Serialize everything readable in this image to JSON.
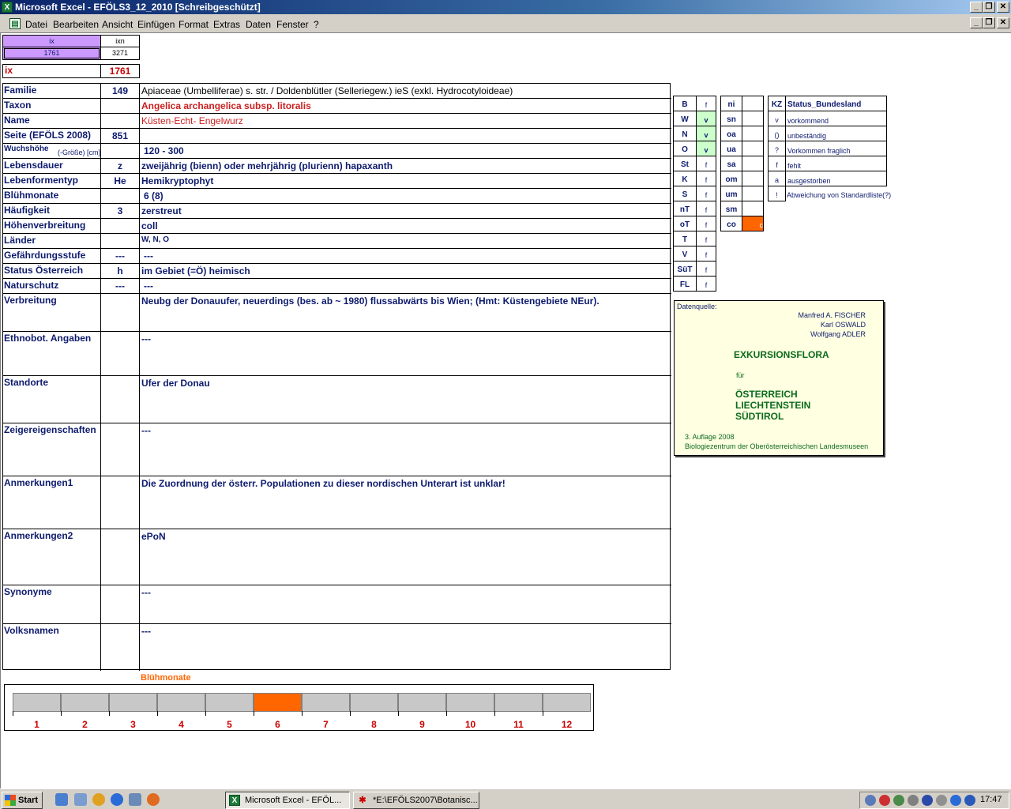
{
  "window": {
    "title": "Microsoft Excel - EFÖLS3_12_2010  [Schreibgeschützt]"
  },
  "menu": [
    "Datei",
    "Bearbeiten",
    "Ansicht",
    "Einfügen",
    "Format",
    "Extras",
    "Daten",
    "Fenster",
    "?"
  ],
  "index_box": {
    "ix_header": "ix",
    "ixn_header": "ixn",
    "ix_value": "1761",
    "ixn_value": "3271",
    "ix_label": "ix",
    "ix_big": "1761"
  },
  "rows": [
    {
      "label": "Familie",
      "code": "149",
      "value": "Apiaceae (Umbelliferae) s. str.  /  Doldenblütler (Selleriegew.) ieS (exkl. Hydrocotyloideae)"
    },
    {
      "label": "Taxon",
      "code": "",
      "value": "Angelica archangelica subsp. litoralis"
    },
    {
      "label": "Name",
      "code": "",
      "value": "Küsten-Echt- Engelwurz"
    },
    {
      "label": "Seite (EFÖLS 2008)",
      "code": "851",
      "value": ""
    },
    {
      "label": "Wuchshöhe",
      "label_suffix": "(-Größe) [cm]",
      "code": "",
      "value": "120 - 300"
    },
    {
      "label": "Lebensdauer",
      "code": "z",
      "value": "zweijährig (bienn) oder mehrjährig (plurienn) hapaxanth"
    },
    {
      "label": "Lebenformentyp",
      "code": "He",
      "value": "Hemikryptophyt"
    },
    {
      "label": "Blühmonate",
      "code": "",
      "value": "6 (8)"
    },
    {
      "label": "Häufigkeit",
      "code": "3",
      "value": "zerstreut"
    },
    {
      "label": "Höhenverbreitung",
      "code": "",
      "value": "coll"
    },
    {
      "label": "Länder",
      "code": "",
      "value": "W, N, O"
    },
    {
      "label": "Gefährdungsstufe",
      "code": "---",
      "value": "---"
    },
    {
      "label": "Status Österreich",
      "code": "h",
      "value": "im Gebiet (=Ö) heimisch"
    },
    {
      "label": "Naturschutz",
      "code": "---",
      "value": "---"
    },
    {
      "label": "Verbreitung",
      "code": "",
      "value": "Neubg der Donauufer, neuerdings (bes. ab ~ 1980) flussabwärts bis Wien; (Hmt: Küstengebiete NEur)."
    },
    {
      "label": "Ethnobot. Angaben",
      "code": "",
      "value": "---"
    },
    {
      "label": "Standorte",
      "code": "",
      "value": "Ufer der Donau"
    },
    {
      "label": "Zeigereigenschaften",
      "code": "",
      "value": "---"
    },
    {
      "label": "Anmerkungen1",
      "code": "",
      "value": "Die Zuordnung der österr. Populationen zu dieser nordischen Unterart ist unklar!"
    },
    {
      "label": "Anmerkungen2",
      "code": "",
      "value": "ePoN"
    },
    {
      "label": "Synonyme",
      "code": "",
      "value": "---"
    },
    {
      "label": "Volksnamen",
      "code": "",
      "value": "---"
    }
  ],
  "bundesland": [
    {
      "code": "B",
      "val": "f"
    },
    {
      "code": "W",
      "val": "v"
    },
    {
      "code": "N",
      "val": "v"
    },
    {
      "code": "O",
      "val": "v"
    },
    {
      "code": "St",
      "val": "f"
    },
    {
      "code": "K",
      "val": "f"
    },
    {
      "code": "S",
      "val": "f"
    },
    {
      "code": "nT",
      "val": "f"
    },
    {
      "code": "oT",
      "val": "f"
    },
    {
      "code": "T",
      "val": "f"
    },
    {
      "code": "V",
      "val": "f"
    },
    {
      "code": "SüT",
      "val": "f"
    },
    {
      "code": "FL",
      "val": "f"
    }
  ],
  "hoehe": [
    {
      "code": "ni",
      "val": ""
    },
    {
      "code": "sn",
      "val": ""
    },
    {
      "code": "oa",
      "val": ""
    },
    {
      "code": "ua",
      "val": ""
    },
    {
      "code": "sa",
      "val": ""
    },
    {
      "code": "om",
      "val": ""
    },
    {
      "code": "um",
      "val": ""
    },
    {
      "code": "sm",
      "val": ""
    },
    {
      "code": "co",
      "val": "c"
    }
  ],
  "legend": {
    "header_code": "KZ",
    "header_label": "Status_Bundesland",
    "items": [
      {
        "code": "v",
        "label": "vorkommend"
      },
      {
        "code": "()",
        "label": "unbeständig"
      },
      {
        "code": "?",
        "label": "Vorkommen fraglich"
      },
      {
        "code": "f",
        "label": "fehlt"
      },
      {
        "code": "a",
        "label": "ausgestorben"
      },
      {
        "code": "!",
        "label": "Abweichung von Standardliste(?)"
      }
    ]
  },
  "source": {
    "label": "Datenquelle:",
    "authors": [
      "Manfred A. FISCHER",
      "Karl OSWALD",
      "Wolfgang ADLER"
    ],
    "title": "EXKURSIONSFLORA",
    "fuer": "für",
    "regions": [
      "ÖSTERREICH",
      "LIECHTENSTEIN",
      "SÜDTIROL"
    ],
    "edition": "3. Auflage 2008",
    "publisher": "Biologiezentrum der Oberösterreichischen Landesmuseen"
  },
  "bloom_chart": {
    "title": "Blühmonate",
    "months": [
      "1",
      "2",
      "3",
      "4",
      "5",
      "6",
      "7",
      "8",
      "9",
      "10",
      "11",
      "12"
    ],
    "active": [
      6
    ]
  },
  "taskbar": {
    "start": "Start",
    "tasks": [
      "Microsoft Excel - EFÖL...",
      "*E:\\EFÖLS2007\\Botanisc..."
    ],
    "clock": "17:47"
  },
  "colors": {
    "accent_orange": "#ff6600",
    "purple": "#cc99ff",
    "green_cell": "#ccffcc",
    "dark_blue": "#0d1b6e",
    "red": "#cc0000"
  }
}
